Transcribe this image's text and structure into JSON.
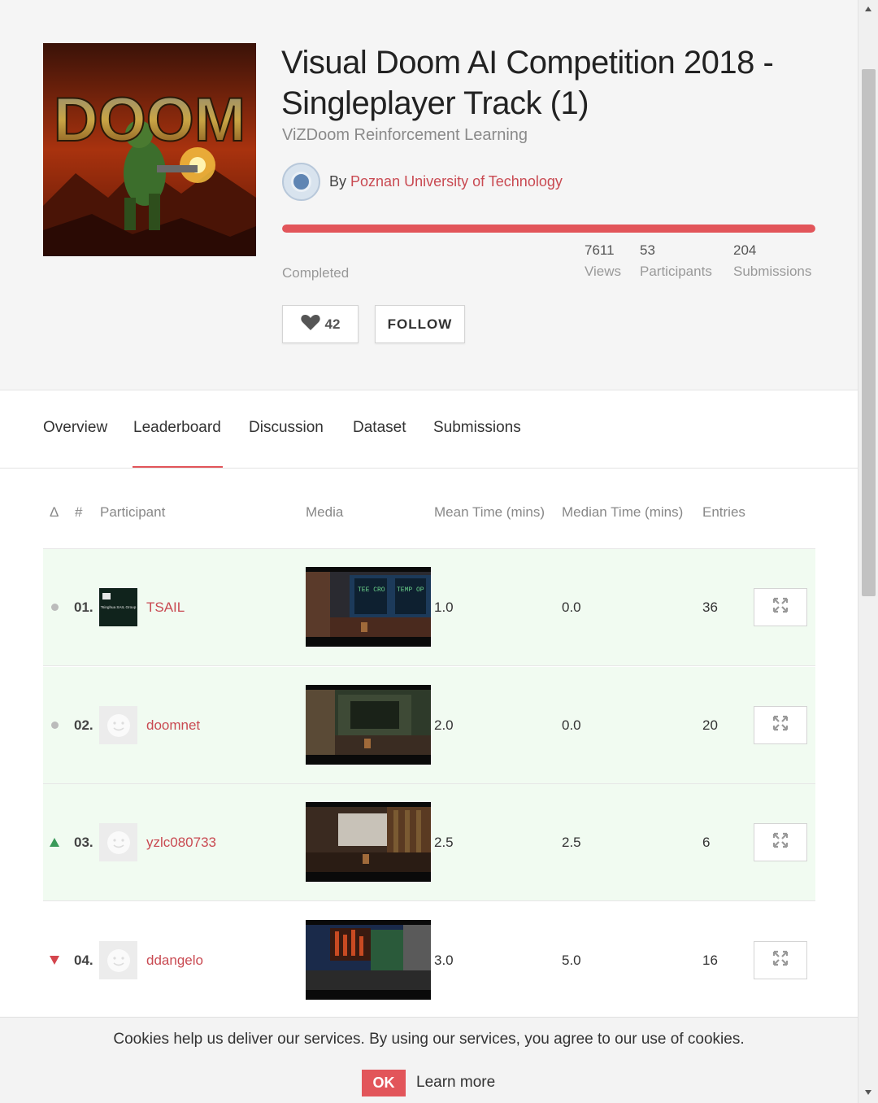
{
  "competition": {
    "title": "Visual Doom AI Competition 2018 - Singleplayer Track (1)",
    "subtitle": "ViZDoom Reinforcement Learning",
    "by_prefix": "By",
    "organizer": "Poznan University of Technology",
    "status": "Completed",
    "progress_fraction": 1.0,
    "stats": [
      {
        "value": "7611",
        "label": "Views"
      },
      {
        "value": "53",
        "label": "Participants"
      },
      {
        "value": "204",
        "label": "Submissions"
      }
    ],
    "cover_logo_text": "DOOM",
    "likes": "42",
    "follow_label": "FOLLOW"
  },
  "tabs": [
    {
      "label": "Overview",
      "active": false
    },
    {
      "label": "Leaderboard",
      "active": true
    },
    {
      "label": "Discussion",
      "active": false
    },
    {
      "label": "Dataset",
      "active": false
    },
    {
      "label": "Submissions",
      "active": false
    }
  ],
  "leaderboard": {
    "headers": {
      "delta": "Δ",
      "rank": "#",
      "participant": "Participant",
      "media": "Media",
      "mean": "Mean Time (mins)",
      "median": "Median Time (mins)",
      "entries": "Entries"
    },
    "rows": [
      {
        "trend": "same",
        "rank": "01.",
        "name": "TSAIL",
        "avatar": "team-logo",
        "avatar_text": "Tsinghua SAIL Group",
        "mean": "1.0",
        "median": "0.0",
        "entries": "36",
        "highlight": true
      },
      {
        "trend": "same",
        "rank": "02.",
        "name": "doomnet",
        "avatar": "default-face",
        "mean": "2.0",
        "median": "0.0",
        "entries": "20",
        "highlight": true
      },
      {
        "trend": "up",
        "rank": "03.",
        "name": "yzlc080733",
        "avatar": "default-face",
        "mean": "2.5",
        "median": "2.5",
        "entries": "6",
        "highlight": true
      },
      {
        "trend": "down",
        "rank": "04.",
        "name": "ddangelo",
        "avatar": "default-face",
        "mean": "3.0",
        "median": "5.0",
        "entries": "16",
        "highlight": false
      }
    ]
  },
  "cookie": {
    "message": "Cookies help us deliver our services. By using our services, you agree to our use of cookies.",
    "ok_label": "OK",
    "learn_more_label": "Learn more"
  },
  "colors": {
    "accent": "#e2555a",
    "link": "#c94a52",
    "highlight_row": "#f1fbf1",
    "trend_up": "#3a9a5a",
    "trend_down": "#d4454d"
  },
  "icons": {
    "like": "heart-icon",
    "expand": "expand-arrows-icon",
    "trend_same": "dot-icon",
    "trend_up": "triangle-up-icon",
    "trend_down": "triangle-down-icon"
  }
}
